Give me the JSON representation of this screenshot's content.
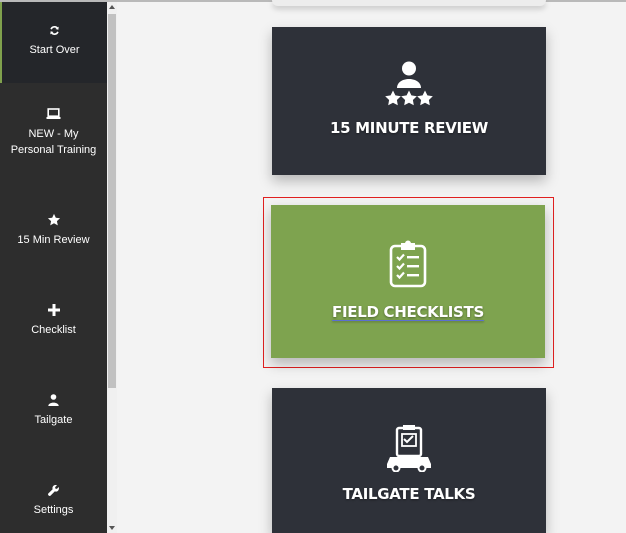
{
  "sidebar": {
    "items": [
      {
        "label": "Start Over",
        "icon": "refresh-icon",
        "active": true
      },
      {
        "label": "NEW - My Personal Training",
        "icon": "laptop-icon",
        "active": false
      },
      {
        "label": "15 Min Review",
        "icon": "star-icon",
        "active": false
      },
      {
        "label": "Checklist",
        "icon": "plus-icon",
        "active": false
      },
      {
        "label": "Tailgate",
        "icon": "user-icon",
        "active": false
      },
      {
        "label": "Settings",
        "icon": "wrench-icon",
        "active": false
      }
    ]
  },
  "main": {
    "cards": [
      {
        "title": "15 MINUTE REVIEW",
        "icon": "person-with-stars-icon",
        "color": "#2e3139"
      },
      {
        "title": "FIELD CHECKLISTS",
        "icon": "clipboard-checklist-icon",
        "color": "#7ea34f"
      },
      {
        "title": "TAILGATE TALKS",
        "icon": "clipboard-car-icon",
        "color": "#2e3139"
      }
    ]
  },
  "colors": {
    "sidebar_bg": "#2d2d2d",
    "accent_green": "#7ea34f",
    "card_dark": "#2e3139",
    "highlight_border": "#e02020"
  }
}
